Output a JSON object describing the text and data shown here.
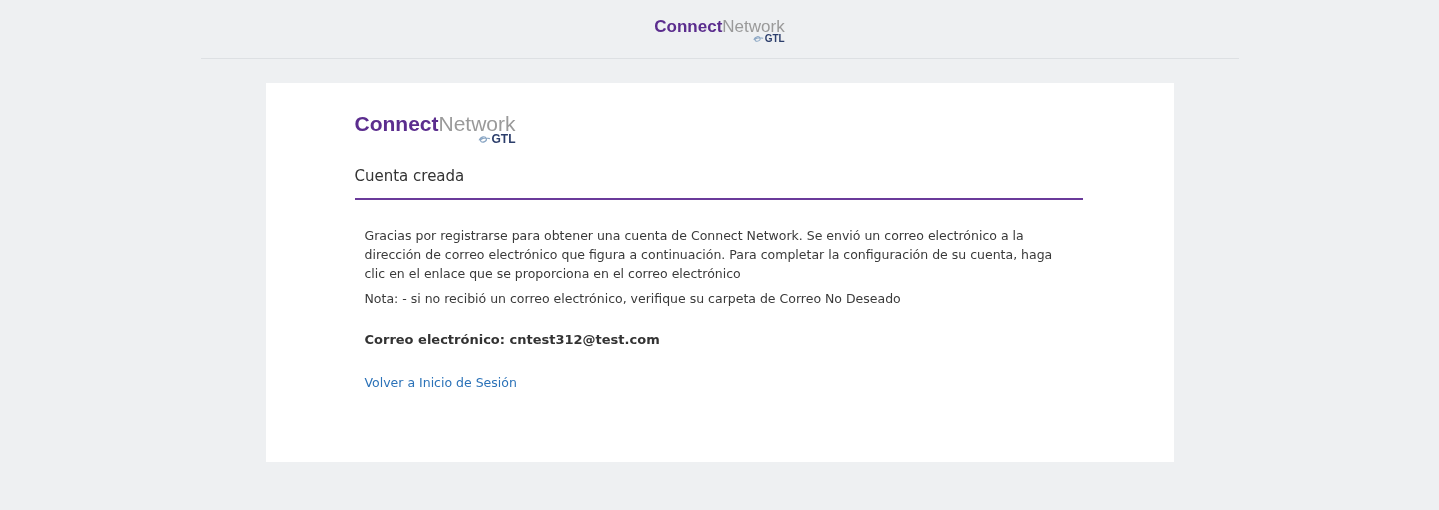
{
  "header": {
    "logo": {
      "wordmark": "**Connect**Network",
      "sub": "GTL"
    }
  },
  "card": {
    "logo": {
      "wordmark": "**Connect**Network",
      "sub": "GTL"
    },
    "title": "Cuenta creada",
    "message": "Gracias por registrarse para obtener una cuenta de Connect Network. Se envió un correo electrónico a la dirección de correo electrónico que figura a continuación. Para completar la configuración de su cuenta, haga clic en el enlace que se proporciona en el correo electrónico",
    "note": "Nota: - si no recibió un correo electrónico, verifique su carpeta de Correo No Deseado",
    "email": "Correo electrónico: cntest312@test.com",
    "link": "Volver a Inicio de Sesión"
  }
}
